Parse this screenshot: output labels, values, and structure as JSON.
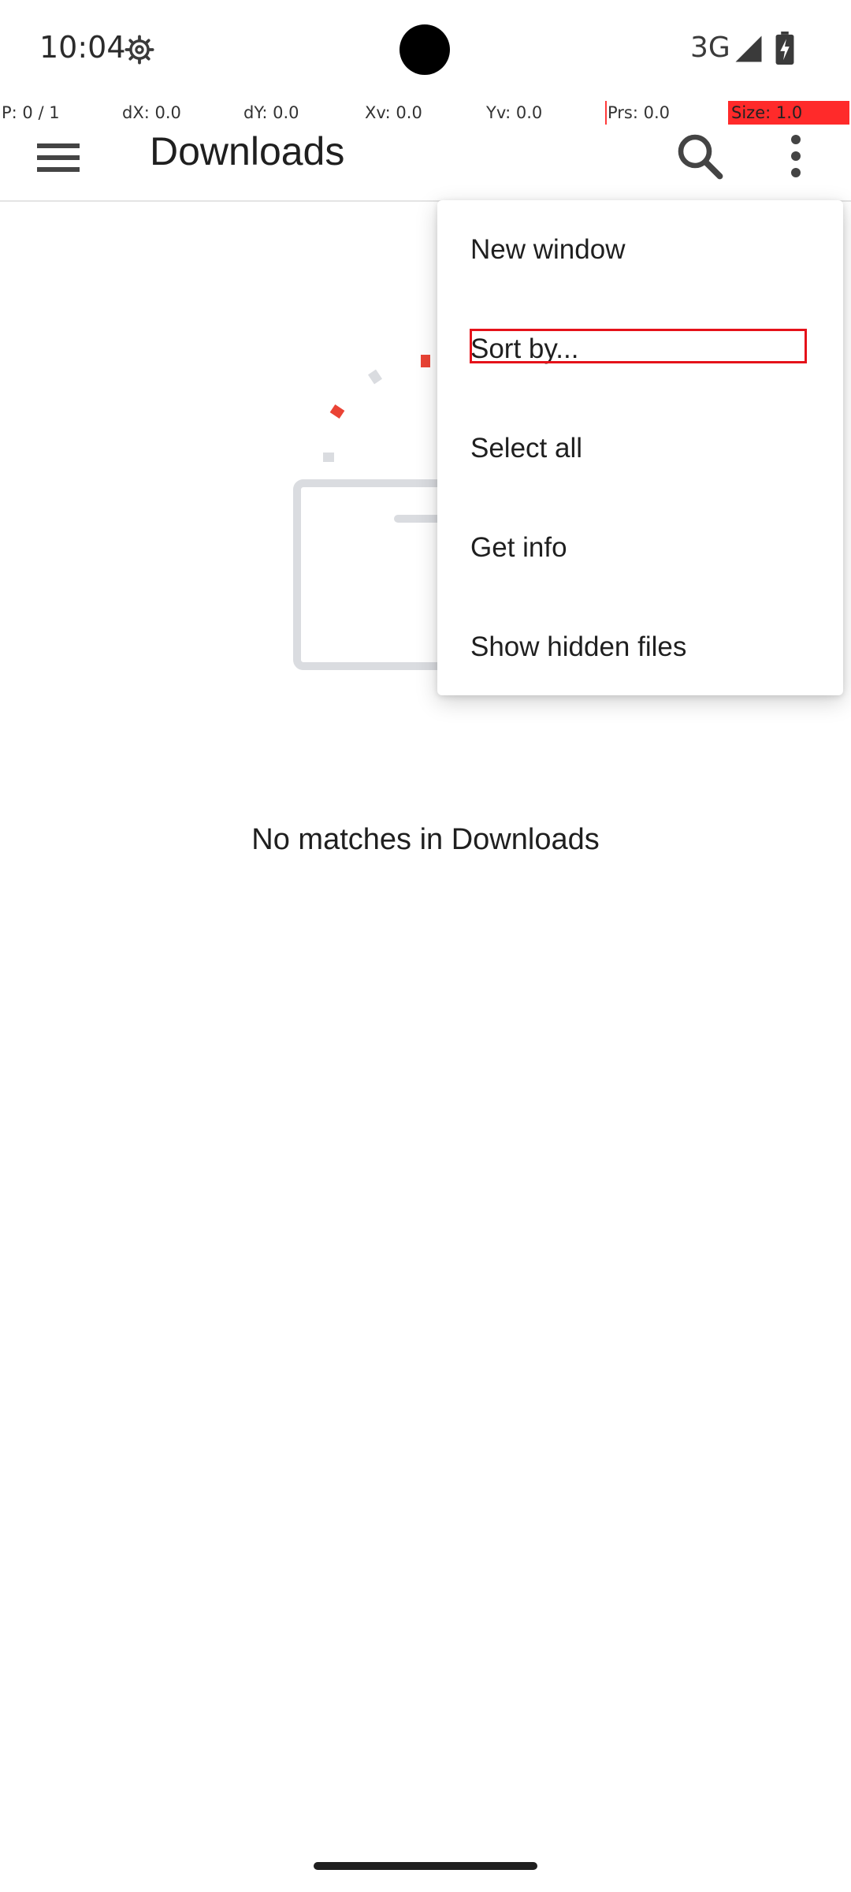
{
  "status_bar": {
    "time": "10:04",
    "network": "3G"
  },
  "pointer_overlay": {
    "p": "P: 0 / 1",
    "dx": "dX: 0.0",
    "dy": "dY: 0.0",
    "xv": "Xv: 0.0",
    "yv": "Yv: 0.0",
    "prs": "Prs: 0.0",
    "size": "Size: 1.0"
  },
  "app_bar": {
    "title": "Downloads",
    "menu_icon": "hamburger-menu-icon",
    "search_icon": "search-icon",
    "overflow_icon": "more-vert-icon"
  },
  "empty_state": {
    "message": "No matches in Downloads",
    "illustration": "empty-folder-illustration"
  },
  "overflow_menu": {
    "items": [
      {
        "label": "New window"
      },
      {
        "label": "Sort by..."
      },
      {
        "label": "Select all"
      },
      {
        "label": "Get info"
      },
      {
        "label": "Show hidden files"
      }
    ],
    "highlighted_item": "Sort by..."
  },
  "colors": {
    "accent_red": "#e5121a",
    "illustration_gray": "#dadce0",
    "illustration_red": "#ea4335",
    "text_primary": "#1f1f1f"
  }
}
